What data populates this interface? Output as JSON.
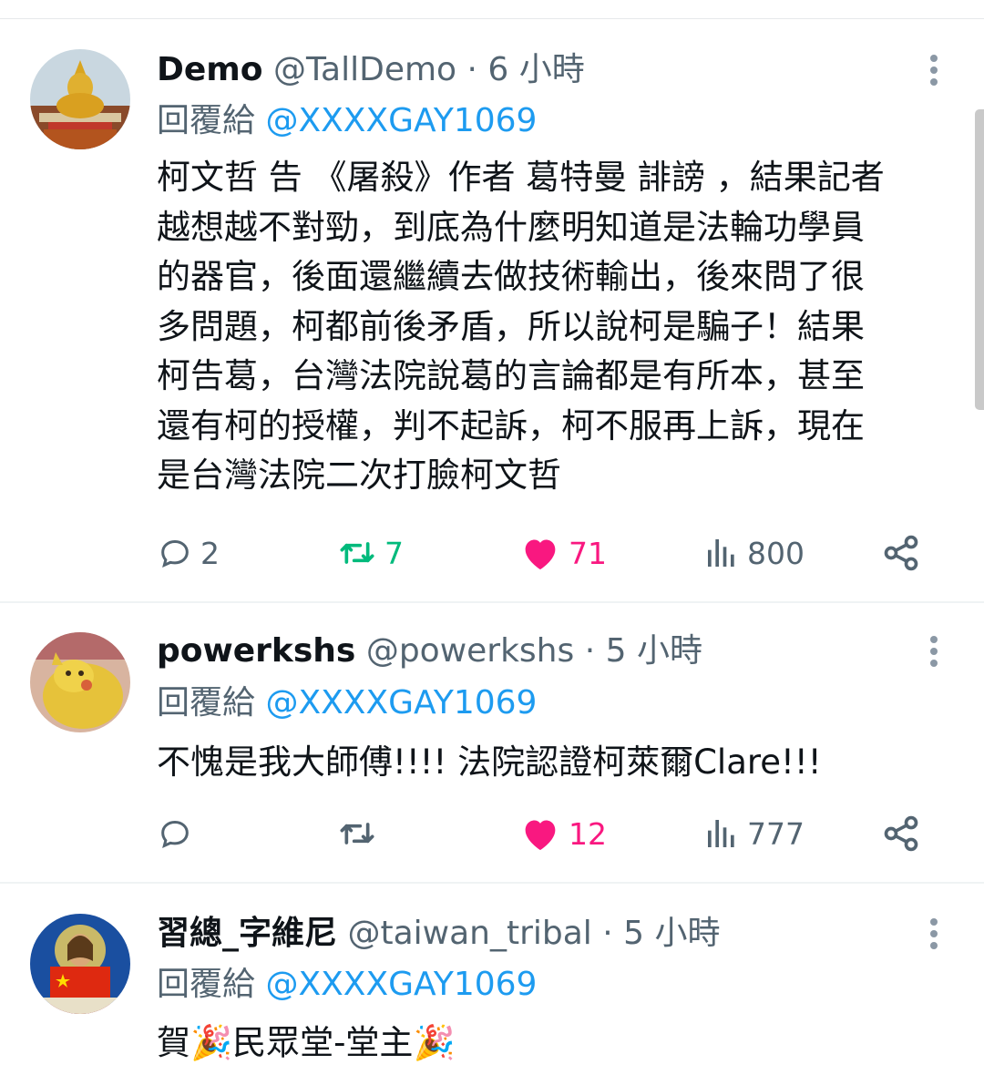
{
  "tweets": [
    {
      "display_name": "Demo",
      "handle": "@TallDemo",
      "time": "· 6 小時",
      "reply_prefix": "回覆給",
      "reply_handle": "@XXXXGAY1069",
      "text_lines": [
        "柯文哲 告 《屠殺》作者 葛特曼 誹謗 ，結果記者",
        "越想越不對勁，到底為什麼明知道是法輪功學員",
        "的器官，後面還繼續去做技術輸出，後來問了很",
        "多問題，柯都前後矛盾，所以說柯是騙子！結果",
        "柯告葛，台灣法院說葛的言論都是有所本，甚至",
        "還有柯的授權，判不起訴，柯不服再上訴，現在",
        "是台灣法院二次打臉柯文哲"
      ],
      "replies": "2",
      "retweets": "7",
      "likes": "71",
      "views": "800",
      "retweeted": true,
      "liked": true
    },
    {
      "display_name": "powerkshs",
      "handle": "@powerkshs",
      "time": "· 5 小時",
      "reply_prefix": "回覆給",
      "reply_handle": "@XXXXGAY1069",
      "text_lines": [
        "不愧是我大師傅!!!! 法院認證柯萊爾Clare!!!"
      ],
      "replies": "",
      "retweets": "",
      "likes": "12",
      "views": "777",
      "retweeted": false,
      "liked": true
    },
    {
      "display_name": "習總_字維尼",
      "handle": "@taiwan_tribal",
      "time": "· 5 小時",
      "reply_prefix": "回覆給",
      "reply_handle": "@XXXXGAY1069",
      "text_parts": [
        "賀",
        "🎉",
        "民眾堂-堂主",
        "🎉"
      ]
    }
  ],
  "icons": {
    "reply": "reply-icon",
    "retweet": "retweet-icon",
    "like": "heart-icon",
    "views": "views-icon",
    "share": "share-icon",
    "more": "more-dots-icon"
  },
  "colors": {
    "link": "#1d9bf0",
    "muted": "#536471",
    "retweet": "#00ba7c",
    "like": "#f91880"
  }
}
